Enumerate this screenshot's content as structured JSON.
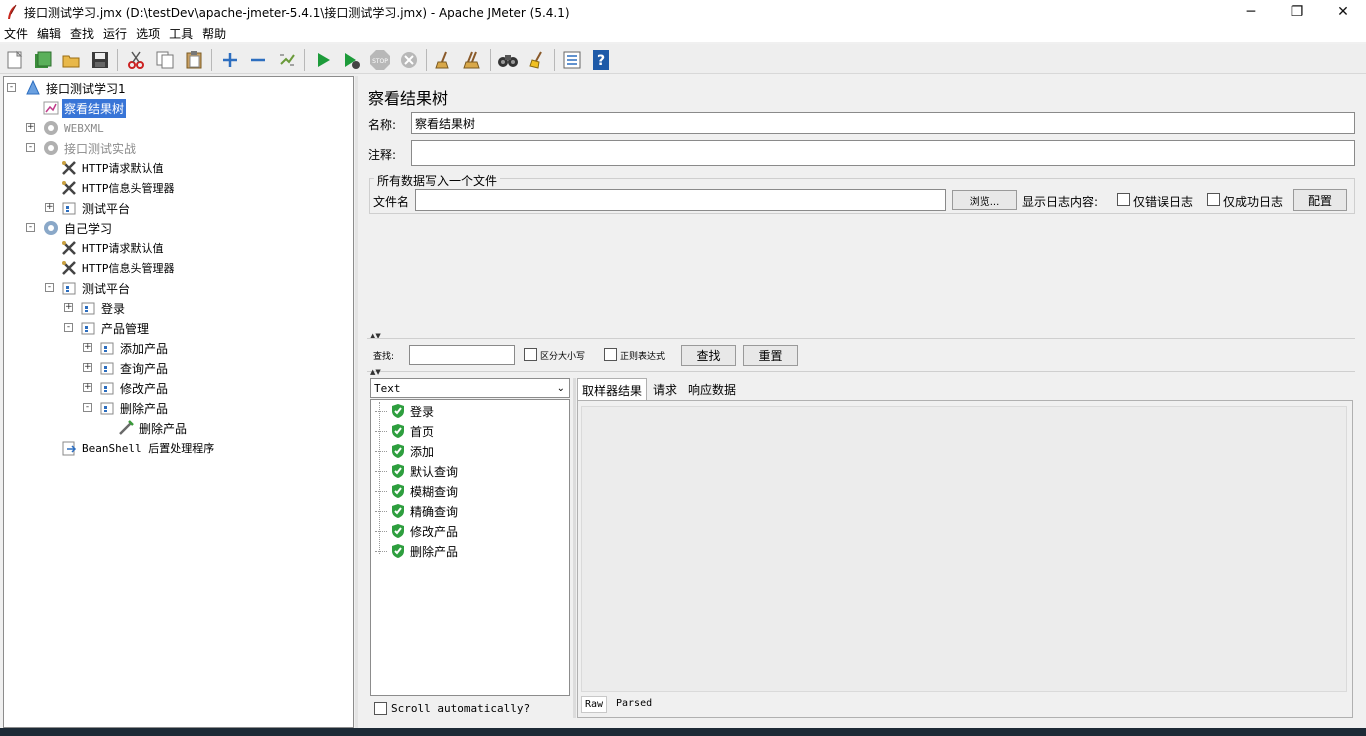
{
  "window": {
    "title": "接口测试学习.jmx (D:\\testDev\\apache-jmeter-5.4.1\\接口测试学习.jmx) - Apache JMeter (5.4.1)"
  },
  "menu": [
    "文件",
    "编辑",
    "查找",
    "运行",
    "选项",
    "工具",
    "帮助"
  ],
  "toolbar": {
    "buttons": [
      "new-icon",
      "templates-icon",
      "open-icon",
      "save-icon",
      "cut-icon",
      "copy-icon",
      "paste-icon",
      "expand-icon",
      "collapse-icon",
      "toggle-icon",
      "start-icon",
      "start-no-pause-icon",
      "stop-icon",
      "shutdown-icon",
      "clear-icon",
      "clear-all-icon",
      "search-icon",
      "reset-search-icon",
      "function-helper-icon",
      "help-icon"
    ]
  },
  "tree": {
    "items": [
      {
        "label": "接口测试学习1",
        "icon": "test-plan-icon"
      },
      {
        "label": "察看结果树",
        "icon": "view-results-tree-icon"
      },
      {
        "label": "WEBXML",
        "icon": "thread-group-icon"
      },
      {
        "label": "接口测试实战",
        "icon": "thread-group-icon"
      },
      {
        "label": "HTTP请求默认值",
        "icon": "config-element-icon"
      },
      {
        "label": "HTTP信息头管理器",
        "icon": "config-element-icon"
      },
      {
        "label": "测试平台",
        "icon": "controller-icon"
      },
      {
        "label": "自己学习",
        "icon": "thread-group-icon"
      },
      {
        "label": "HTTP请求默认值",
        "icon": "config-element-icon"
      },
      {
        "label": "HTTP信息头管理器",
        "icon": "config-element-icon"
      },
      {
        "label": "测试平台",
        "icon": "controller-icon"
      },
      {
        "label": "登录",
        "icon": "controller-icon"
      },
      {
        "label": "产品管理",
        "icon": "controller-icon"
      },
      {
        "label": "添加产品",
        "icon": "controller-icon"
      },
      {
        "label": "查询产品",
        "icon": "controller-icon"
      },
      {
        "label": "修改产品",
        "icon": "controller-icon"
      },
      {
        "label": "删除产品",
        "icon": "controller-icon"
      },
      {
        "label": "删除产品",
        "icon": "sampler-icon"
      },
      {
        "label": "BeanShell 后置处理程序",
        "icon": "postprocessor-icon"
      }
    ]
  },
  "panel": {
    "title": "察看结果树",
    "name_label": "名称:",
    "name_value": "察看结果树",
    "comment_label": "注释:",
    "comment_value": "",
    "file_group_title": "所有数据写入一个文件",
    "filename_label": "文件名",
    "filename_value": "",
    "browse_label": "浏览...",
    "log_content_label": "显示日志内容:",
    "errors_only_label": "仅错误日志",
    "success_only_label": "仅成功日志",
    "configure_label": "配置"
  },
  "search": {
    "label": "查找:",
    "value": "",
    "case_sensitive_label": "区分大小写",
    "regex_label": "正则表达式",
    "search_button": "查找",
    "reset_button": "重置"
  },
  "results": {
    "renderer": "Text",
    "items": [
      "登录",
      "首页",
      "添加",
      "默认查询",
      "模糊查询",
      "精确查询",
      "修改产品",
      "删除产品"
    ],
    "scroll_label": "Scroll automatically?",
    "tabs": [
      "取样器结果",
      "请求",
      "响应数据"
    ],
    "bottom_tabs": [
      "Raw",
      "Parsed"
    ]
  },
  "colors": {
    "selection": "#3875d7",
    "success_shield": "#2e9e3e",
    "run_green": "#1d9b3a"
  }
}
